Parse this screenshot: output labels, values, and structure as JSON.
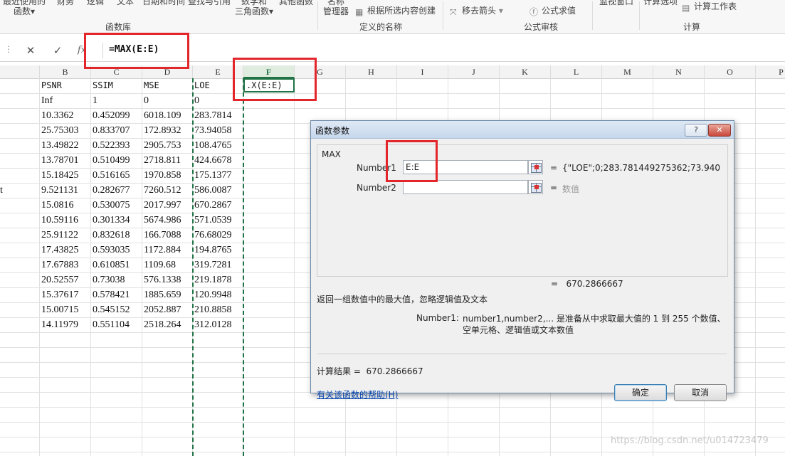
{
  "ribbon": {
    "items": [
      {
        "line1": "最近使用的",
        "line2": "函数▾"
      },
      {
        "line1": "财务",
        "line2": ""
      },
      {
        "line1": "逻辑",
        "line2": ""
      },
      {
        "line1": "文本",
        "line2": ""
      },
      {
        "line1": "日期和时间",
        "line2": ""
      },
      {
        "line1": "查找与引用",
        "line2": ""
      },
      {
        "line1": "数学和",
        "line2": "三角函数▾"
      },
      {
        "line1": "其他函数",
        "line2": ""
      },
      {
        "line1": "名称",
        "line2": "管理器"
      }
    ],
    "defined_names_item": "根据所选内容创建",
    "remove_arrows": "移去箭头",
    "evaluate_formula": "公式求值",
    "watch_window": "监视窗口",
    "calc_options": "计算选项",
    "calc_sheet": "计算工作表",
    "groups": {
      "function_library": "函数库",
      "defined_names": "定义的名称",
      "formula_auditing": "公式审核",
      "calculation": "计算"
    }
  },
  "formula_bar": {
    "cancel_symbol": "✕",
    "enter_symbol": "✓",
    "fx_symbol": "fx",
    "formula": "=MAX(E:E)"
  },
  "columns": [
    "B",
    "C",
    "D",
    "E",
    "F",
    "G",
    "H",
    "I",
    "J",
    "K",
    "L",
    "M",
    "N",
    "O",
    "P"
  ],
  "active_column": "F",
  "partial_left_text": "t",
  "table": {
    "headers": [
      "PSNR",
      "SSIM",
      "MSE",
      "LOE"
    ],
    "rows": [
      [
        "Inf",
        "1",
        "0",
        "0"
      ],
      [
        "10.3362",
        "0.452099",
        "6018.109",
        "283.7814"
      ],
      [
        "25.75303",
        "0.833707",
        "172.8932",
        "73.94058"
      ],
      [
        "13.49822",
        "0.522393",
        "2905.753",
        "108.4765"
      ],
      [
        "13.78701",
        "0.510499",
        "2718.811",
        "424.6678"
      ],
      [
        "15.18425",
        "0.516165",
        "1970.858",
        "175.1377"
      ],
      [
        "9.521131",
        "0.282677",
        "7260.512",
        "586.0087"
      ],
      [
        "15.0816",
        "0.530075",
        "2017.997",
        "670.2867"
      ],
      [
        "10.59116",
        "0.301334",
        "5674.986",
        "571.0539"
      ],
      [
        "25.91122",
        "0.832618",
        "166.7088",
        "76.68029"
      ],
      [
        "17.43825",
        "0.593035",
        "1172.884",
        "194.8765"
      ],
      [
        "17.67883",
        "0.610851",
        "1109.68",
        "319.7281"
      ],
      [
        "20.52557",
        "0.73038",
        "576.1338",
        "219.1878"
      ],
      [
        "15.37617",
        "0.578421",
        "1885.659",
        "120.9948"
      ],
      [
        "15.00715",
        "0.545152",
        "2052.887",
        "210.8858"
      ],
      [
        "14.11979",
        "0.551104",
        "2518.264",
        "312.0128"
      ]
    ]
  },
  "active_cell_text": ".X(E:E)",
  "dialog": {
    "title": "函数参数",
    "help_btn": "?",
    "close_btn": "✕",
    "function_name": "MAX",
    "number1_label": "Number1",
    "number1_value": "E:E",
    "number1_result": "{\"LOE\";0;283.781449275362;73.940",
    "number2_label": "Number2",
    "number2_value": "",
    "number2_result": "数值",
    "equals": "=",
    "overall_result": "670.2866667",
    "description": "返回一组数值中的最大值，忽略逻辑值及文本",
    "arg_help_name": "Number1:",
    "arg_help_text": "number1,number2,... 是准备从中求取最大值的 1 到 255 个数值、空单元格、逻辑值或文本数值",
    "calc_result_label": "计算结果 =",
    "calc_result_value": "670.2866667",
    "help_link": "有关该函数的帮助(H)",
    "ok": "确定",
    "cancel": "取消"
  },
  "watermark": "https://blog.csdn.net/u014723479"
}
